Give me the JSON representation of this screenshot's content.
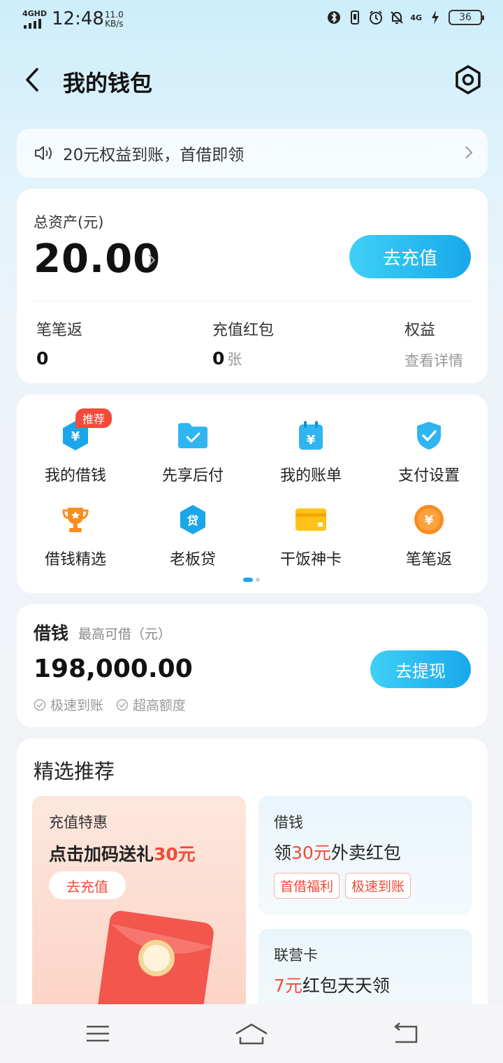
{
  "status_bar": {
    "network": "4GHD",
    "time": "12:48",
    "speed_value": "11.0",
    "speed_unit": "KB/s",
    "network_right": "4G",
    "battery": "36"
  },
  "header": {
    "title": "我的钱包"
  },
  "notice": {
    "text": "20元权益到账，首借即领"
  },
  "assets": {
    "label": "总资产(元)",
    "amount": "20.00",
    "recharge_label": "去充值",
    "stats": [
      {
        "label": "笔笔返",
        "value": "0"
      },
      {
        "label": "充值红包",
        "value": "0",
        "unit": "张"
      },
      {
        "label": "权益",
        "link": "查看详情"
      }
    ]
  },
  "grid": {
    "badge": "推荐",
    "items": [
      {
        "label": "我的借钱",
        "icon": "borrow-shield-icon"
      },
      {
        "label": "先享后付",
        "icon": "folder-check-icon"
      },
      {
        "label": "我的账单",
        "icon": "calendar-yuan-icon"
      },
      {
        "label": "支付设置",
        "icon": "shield-check-icon"
      },
      {
        "label": "借钱精选",
        "icon": "trophy-icon"
      },
      {
        "label": "老板贷",
        "icon": "loan-hexagon-icon"
      },
      {
        "label": "干饭神卡",
        "icon": "card-icon"
      },
      {
        "label": "笔笔返",
        "icon": "coin-icon"
      }
    ],
    "page_count": 2,
    "active_page": 1
  },
  "borrow": {
    "title": "借钱",
    "subtitle": "最高可借（元）",
    "amount": "198,000.00",
    "features": [
      "极速到账",
      "超高额度"
    ],
    "withdraw_label": "去提现"
  },
  "featured": {
    "title": "精选推荐",
    "promo": {
      "title": "充值特惠",
      "line_prefix": "点击加码送礼",
      "line_highlight": "30元",
      "button": "去充值"
    },
    "borrow_card": {
      "title": "借钱",
      "line_prefix": "领",
      "line_highlight": "30元",
      "line_suffix": "外卖红包",
      "chips": [
        "首借福利",
        "极速到账"
      ]
    },
    "union_card": {
      "title": "联营卡",
      "line_highlight": "7元",
      "line_suffix": "红包天天领"
    }
  },
  "colors": {
    "accent": "#18a8ec",
    "accent_light": "#3fd0f5",
    "red": "#f04b3a",
    "badge_red": "#f34a3c"
  }
}
